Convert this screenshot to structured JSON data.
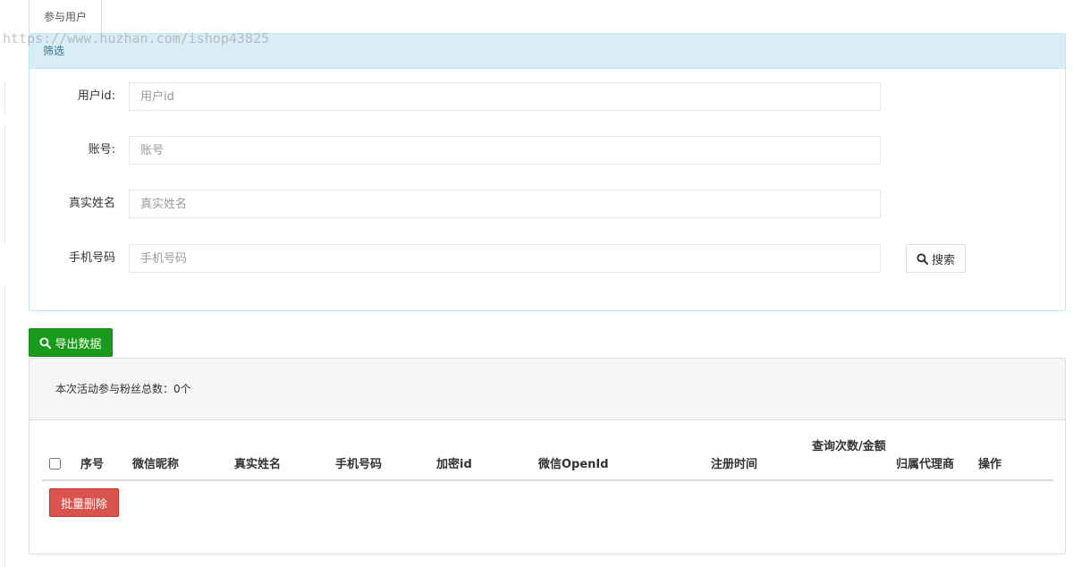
{
  "tab": {
    "label": "参与用户"
  },
  "watermark": "https://www.huzhan.com/ishop43825",
  "filter": {
    "heading": "筛选",
    "fields": [
      {
        "label": "用户id:",
        "placeholder": "用户id",
        "value": ""
      },
      {
        "label": "账号:",
        "placeholder": "账号",
        "value": ""
      },
      {
        "label": "真实姓名",
        "placeholder": "真实姓名",
        "value": ""
      },
      {
        "label": "手机号码",
        "placeholder": "手机号码",
        "value": ""
      }
    ],
    "search_button": {
      "label": "搜索",
      "icon": "search-icon"
    }
  },
  "export_button": {
    "label": "导出数据",
    "icon": "search-icon"
  },
  "list": {
    "summary": "本次活动参与粉丝总数：0个",
    "columns": [
      "序号",
      "微信昵称",
      "真实姓名",
      "手机号码",
      "加密id",
      "微信OpenId",
      "注册时间",
      "查询次数/金额",
      "归属代理商",
      "操作"
    ],
    "rows": []
  },
  "batch_delete_button": {
    "label": "批量删除"
  },
  "colors": {
    "info_heading_bg": "#d9edf7",
    "info_heading_text": "#31708f",
    "success": "#1a9a1a",
    "danger": "#d9534f"
  }
}
